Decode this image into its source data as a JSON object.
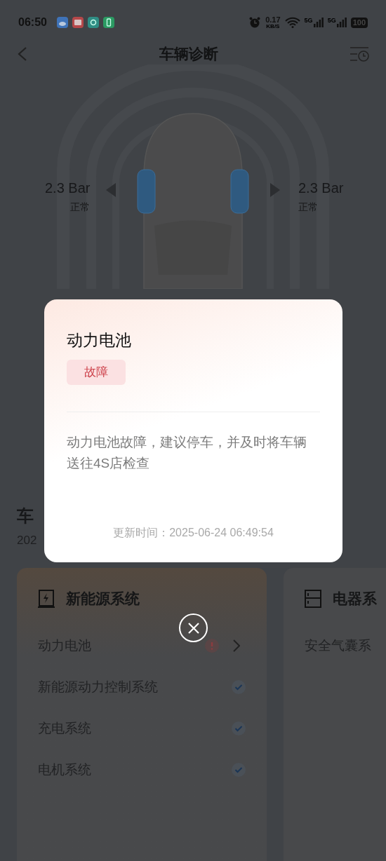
{
  "status_bar": {
    "time": "06:50",
    "network_speed": "0.17",
    "speed_unit": "KB/S",
    "signals": [
      "5G",
      "5G"
    ],
    "battery": "100"
  },
  "nav": {
    "title": "车辆诊断"
  },
  "tire_pressure": [
    {
      "value": "2.3 Bar",
      "status": "正常"
    },
    {
      "value": "2.3 Bar",
      "status": "正常"
    }
  ],
  "section": {
    "title": "车",
    "subtitle": "202"
  },
  "cards": [
    {
      "title": "新能源系统",
      "items": [
        {
          "label": "动力电池",
          "kind": "fault"
        },
        {
          "label": "新能源动力控制系统",
          "kind": "ok"
        },
        {
          "label": "充电系统",
          "kind": "ok"
        },
        {
          "label": "电机系统",
          "kind": "ok"
        }
      ]
    },
    {
      "title": "电器系",
      "items": [
        {
          "label": "安全气囊系",
          "kind": "none"
        }
      ]
    }
  ],
  "dialog": {
    "title": "动力电池",
    "tag": "故障",
    "message": "动力电池故障，建议停车，并及时将车辆送往4S店检查",
    "updated": "更新时间：2025-06-24 06:49:54"
  }
}
